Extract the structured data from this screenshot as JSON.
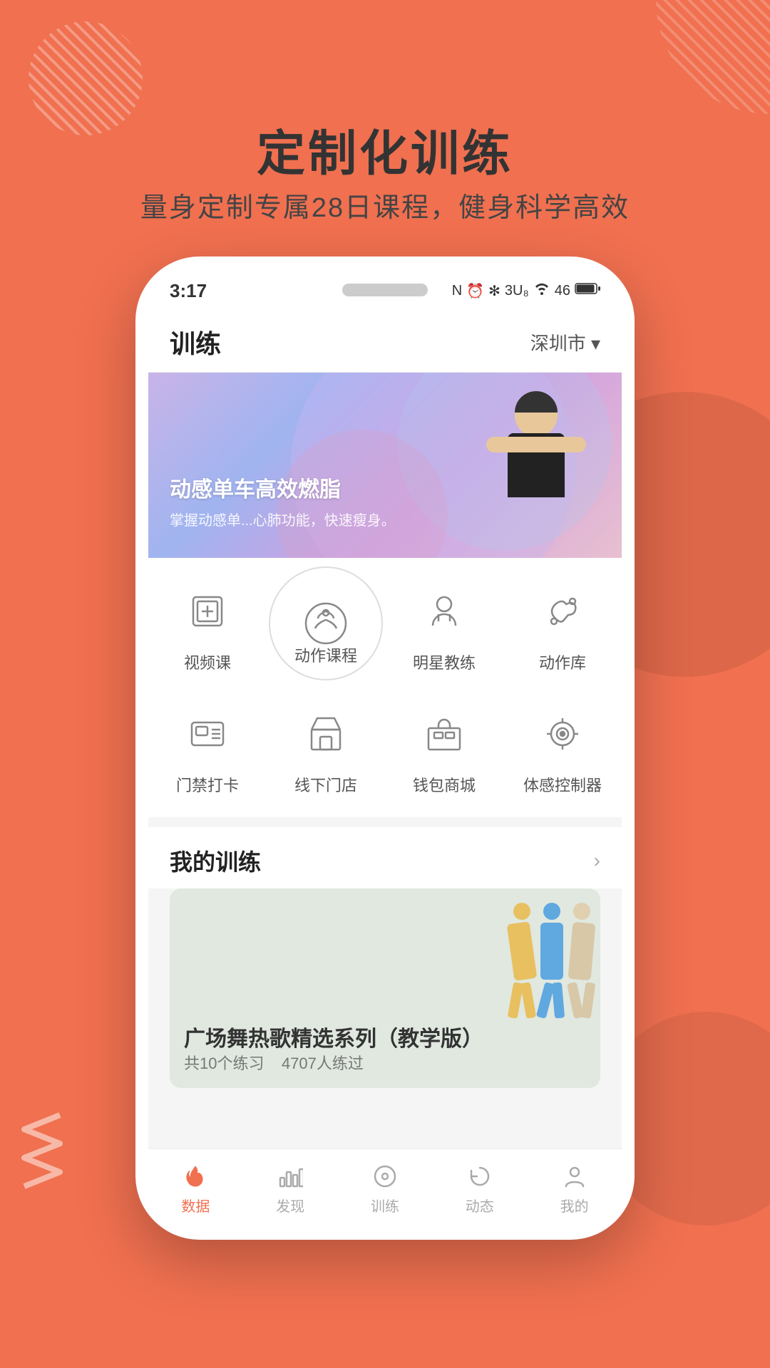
{
  "background_color": "#F07050",
  "hero": {
    "title": "定制化训练",
    "subtitle": "量身定制专属28日课程，健身科学高效"
  },
  "phone": {
    "status_bar": {
      "time": "3:17",
      "icons": "N ⏰ ✻ 3U₈ 46 85"
    },
    "header": {
      "title": "训练",
      "location": "深圳市 ▾"
    },
    "banner": {
      "title": "动感单车高效燃脂",
      "subtitle": "掌握动感单...心肺功能，快速瘦身。"
    },
    "menu": {
      "row1": [
        {
          "label": "视频课",
          "icon": "box-icon",
          "active": false
        },
        {
          "label": "动作课程",
          "icon": "basketball-icon",
          "active": true
        },
        {
          "label": "明星教练",
          "icon": "trainer-icon",
          "active": false
        },
        {
          "label": "动作库",
          "icon": "muscle-icon",
          "active": false
        }
      ],
      "row2": [
        {
          "label": "门禁打卡",
          "icon": "card-icon",
          "active": false
        },
        {
          "label": "线下门店",
          "icon": "store-icon",
          "active": false
        },
        {
          "label": "钱包商城",
          "icon": "shop-icon",
          "active": false
        },
        {
          "label": "体感控制器",
          "icon": "sensor-icon",
          "active": false
        }
      ]
    },
    "my_training": {
      "title": "我的训练",
      "more_icon": "chevron-right-icon",
      "card": {
        "title": "广场舞热歌精选系列（教学版）",
        "meta1": "共10个练习",
        "meta2": "4707人练过"
      }
    },
    "bottom_nav": [
      {
        "label": "数据",
        "icon": "flame-icon",
        "active": true
      },
      {
        "label": "发现",
        "icon": "bar-chart-icon",
        "active": false
      },
      {
        "label": "训练",
        "icon": "disc-icon",
        "active": false
      },
      {
        "label": "动态",
        "icon": "refresh-icon",
        "active": false
      },
      {
        "label": "我的",
        "icon": "person-icon",
        "active": false
      }
    ]
  }
}
